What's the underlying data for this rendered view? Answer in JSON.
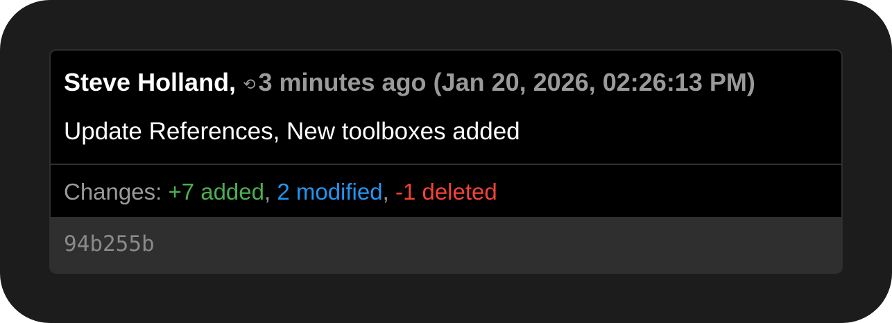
{
  "commit": {
    "author": "Steve Holland,",
    "history_icon": "history-icon",
    "relative_time": "3 minutes ago",
    "absolute_time": "(Jan 20, 2026, 02:26:13 PM)",
    "message": "Update References, New toolboxes added",
    "changes": {
      "label": "Changes:",
      "added": "+7 added",
      "separator1": ",",
      "modified": "2 modified",
      "separator2": ",",
      "deleted": "-1 deleted"
    },
    "hash": "94b255b"
  },
  "colors": {
    "background": "#1c1c1c",
    "card": "#000000",
    "footer": "#2f2f2f",
    "muted_text": "#9a9a9a",
    "added": "#4caf50",
    "modified": "#2196f3",
    "deleted": "#f44336"
  }
}
